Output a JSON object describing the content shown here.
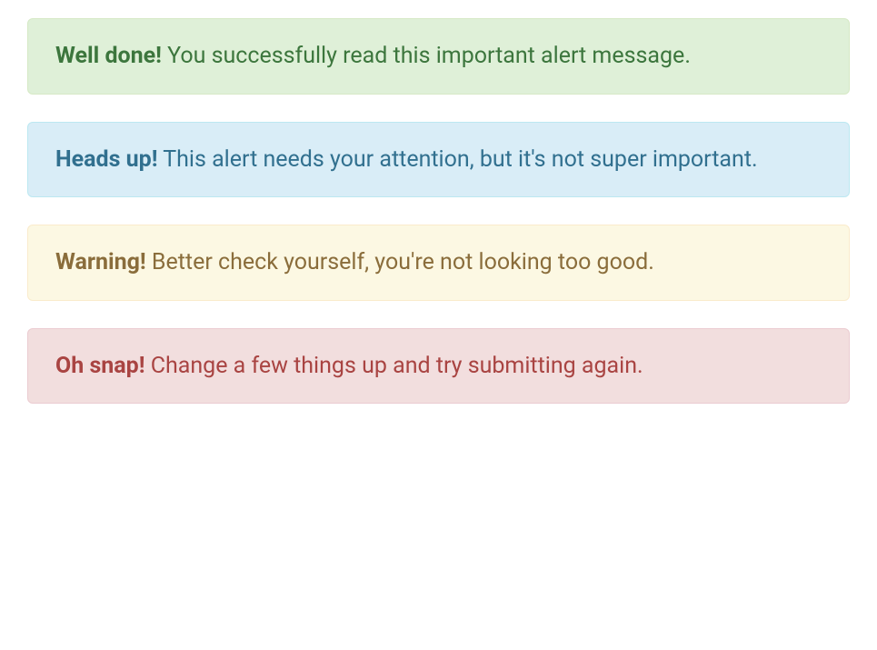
{
  "alerts": [
    {
      "type": "success",
      "strong": "Well done!",
      "text": " You successfully read this important alert message."
    },
    {
      "type": "info",
      "strong": "Heads up!",
      "text": " This alert needs your attention, but it's not super important."
    },
    {
      "type": "warning",
      "strong": "Warning!",
      "text": " Better check yourself, you're not looking too good."
    },
    {
      "type": "danger",
      "strong": "Oh snap!",
      "text": " Change a few things up and try submitting again."
    }
  ]
}
